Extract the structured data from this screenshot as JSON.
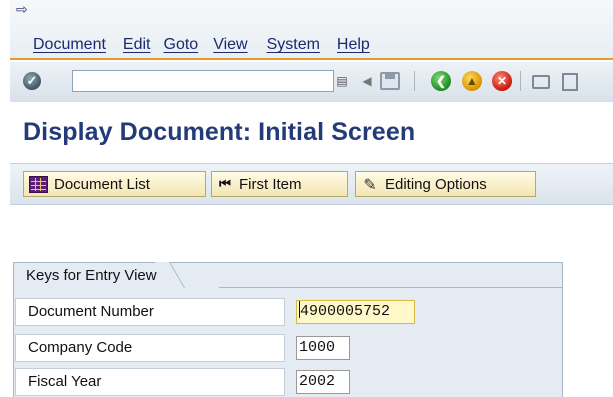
{
  "menubar": {
    "items": [
      "Document",
      "Edit",
      "Goto",
      "View",
      "System",
      "Help"
    ]
  },
  "toolbar": {
    "command_field": "",
    "icons": [
      "enter-check-icon",
      "command-dropdown-icon",
      "previous-arrow-icon",
      "save-icon",
      "back-icon",
      "exit-icon",
      "cancel-icon",
      "print-icon",
      "find-icon"
    ]
  },
  "title": "Display Document: Initial Screen",
  "app_toolbar": {
    "document_list": "Document List",
    "first_item": "First Item",
    "editing_options": "Editing Options"
  },
  "group": {
    "title": "Keys for Entry View",
    "fields": [
      {
        "label": "Document Number",
        "value": "4900005752"
      },
      {
        "label": "Company Code",
        "value": "1000"
      },
      {
        "label": "Fiscal Year",
        "value": "2002"
      }
    ]
  },
  "colors": {
    "title": "#243b7a",
    "menu_text": "#1a2a6c",
    "menu_accent_line": "#e69a30",
    "app_button_bg": "#f3e5b3",
    "group_bg": "#e4ebf2",
    "focused_field_bg": "#fff8c8"
  }
}
